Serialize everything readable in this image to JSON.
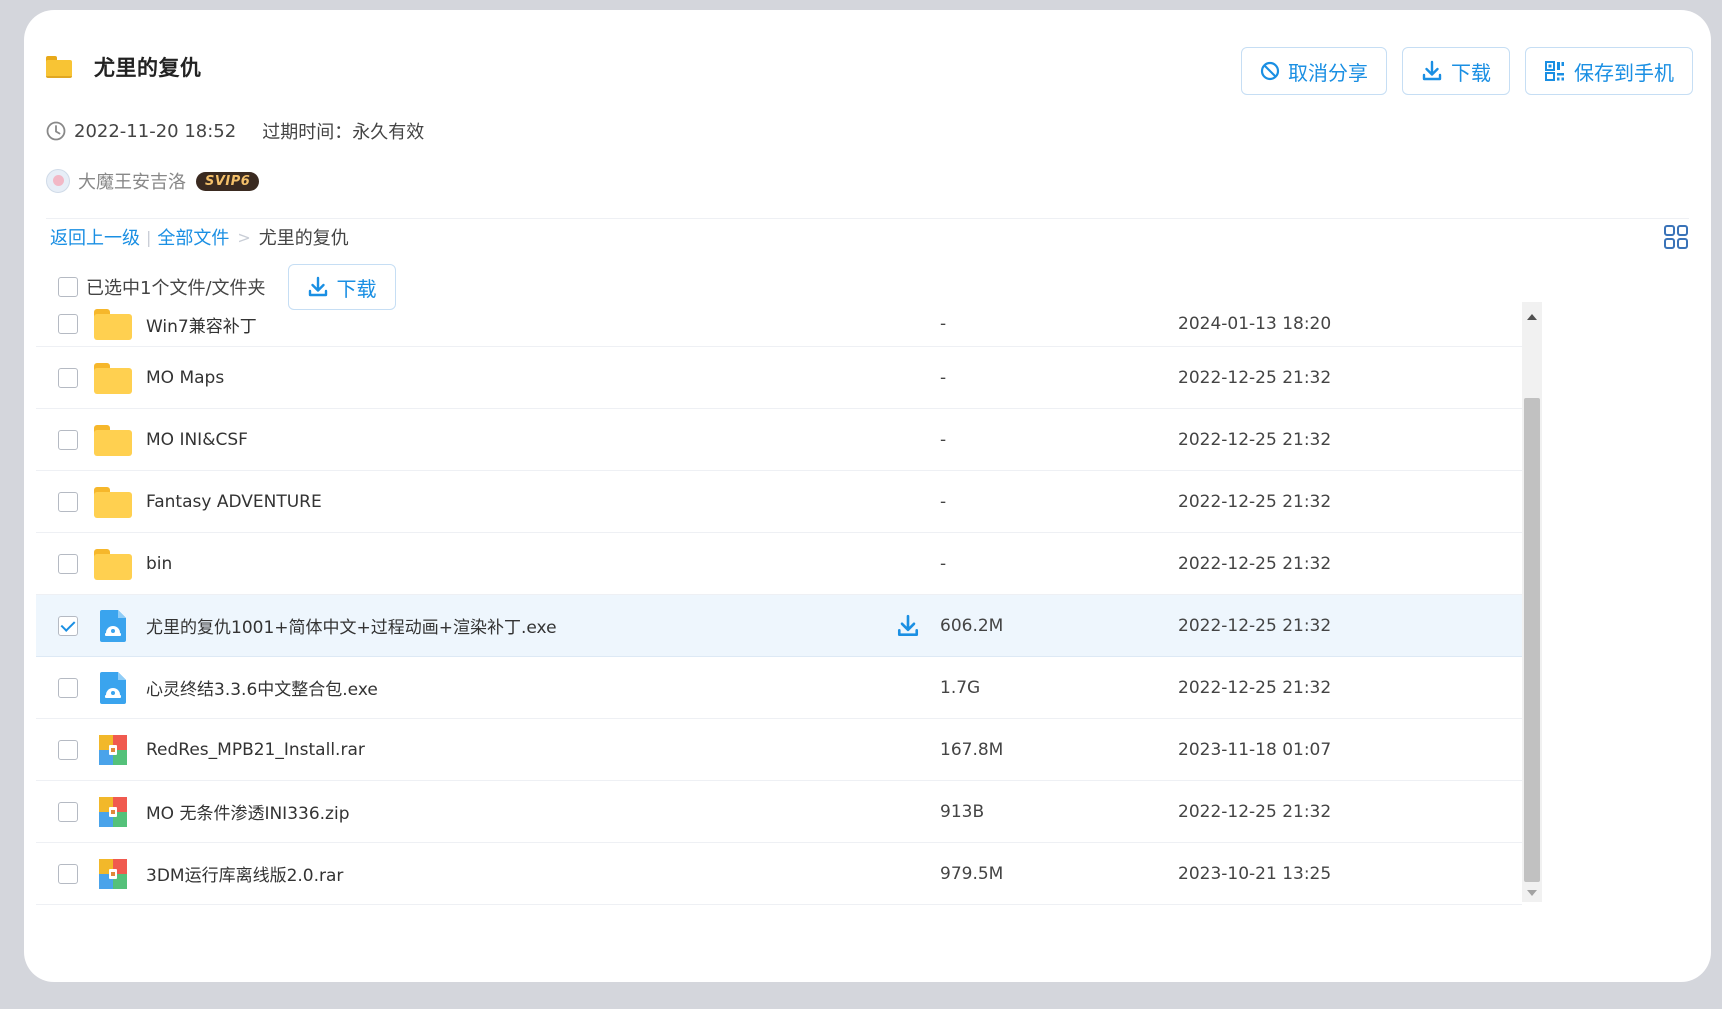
{
  "header": {
    "title": "尤里的复仇",
    "cancel_share_label": "取消分享",
    "download_label": "下载",
    "save_to_phone_label": "保存到手机"
  },
  "meta": {
    "datetime": "2022-11-20 18:52",
    "expire": "过期时间：永久有效"
  },
  "user": {
    "name": "大魔王安吉洛",
    "badge": "SVIP6"
  },
  "breadcrumb": {
    "back": "返回上一级",
    "divider": "|",
    "all_files": "全部文件",
    "arrow": ">",
    "current": "尤里的复仇"
  },
  "selection": {
    "text": "已选中1个文件/文件夹",
    "download_label": "下载"
  },
  "files": [
    {
      "name": "Win7兼容补丁",
      "size": "-",
      "time": "2024-01-13 18:20",
      "type": "folder",
      "checked": false
    },
    {
      "name": "MO Maps",
      "size": "-",
      "time": "2022-12-25 21:32",
      "type": "folder",
      "checked": false
    },
    {
      "name": "MO INI&CSF",
      "size": "-",
      "time": "2022-12-25 21:32",
      "type": "folder",
      "checked": false
    },
    {
      "name": "Fantasy ADVENTURE",
      "size": "-",
      "time": "2022-12-25 21:32",
      "type": "folder",
      "checked": false
    },
    {
      "name": "bin",
      "size": "-",
      "time": "2022-12-25 21:32",
      "type": "folder",
      "checked": false
    },
    {
      "name": "尤里的复仇1001+简体中文+过程动画+渲染补丁.exe",
      "size": "606.2M",
      "time": "2022-12-25 21:32",
      "type": "exe",
      "checked": true
    },
    {
      "name": "心灵终结3.3.6中文整合包.exe",
      "size": "1.7G",
      "time": "2022-12-25 21:32",
      "type": "exe",
      "checked": false
    },
    {
      "name": "RedRes_MPB21_Install.rar",
      "size": "167.8M",
      "time": "2023-11-18 01:07",
      "type": "archive",
      "checked": false
    },
    {
      "name": "MO 无条件渗透INI336.zip",
      "size": "913B",
      "time": "2022-12-25 21:32",
      "type": "archive",
      "checked": false
    },
    {
      "name": "3DM运行库离线版2.0.rar",
      "size": "979.5M",
      "time": "2023-10-21 13:25",
      "type": "archive",
      "checked": false
    }
  ],
  "colors": {
    "accent": "#1a8fe3",
    "selected_row": "#eef6fd",
    "folder": "#ffd050",
    "background": "#d4d6dc"
  },
  "icons": {
    "cancel": "ban-icon",
    "download": "download-icon",
    "save_phone": "qrcode-icon",
    "clock": "clock-icon",
    "grid": "grid-view-icon",
    "folder": "folder-icon",
    "exe": "exe-file-icon",
    "archive": "archive-icon"
  }
}
